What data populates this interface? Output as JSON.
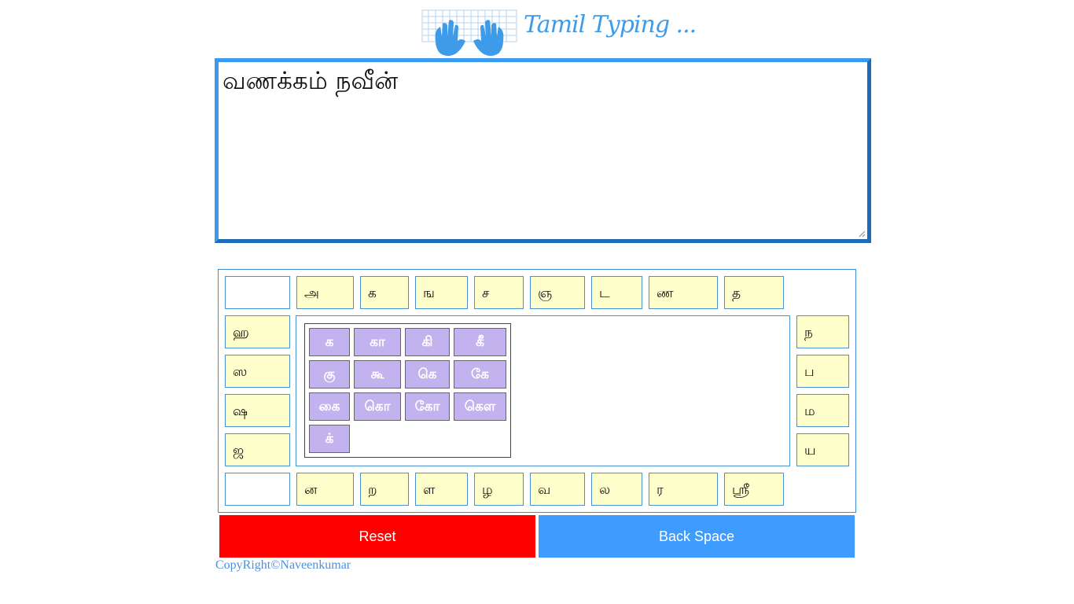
{
  "header": {
    "title": "Tamil Typing ...",
    "logo_icon": "keyboard-hands-icon"
  },
  "editor": {
    "value": "வணக்கம் நவீன்"
  },
  "keyboard": {
    "top_row": [
      "",
      "அ",
      "க",
      "ங",
      "ச",
      "ஞ",
      "ட",
      "ண",
      "த"
    ],
    "left_col": [
      "ஹ",
      "ஸ",
      "ஷ",
      "ஜ"
    ],
    "right_col": [
      "ந",
      "ப",
      "ம",
      "ய"
    ],
    "bottom_row": [
      "",
      "ன",
      "ற",
      "ள",
      "ழ",
      "வ",
      "ல",
      "ர",
      "ஸ்ரீ"
    ],
    "vowel_signs": [
      "க",
      "கா",
      "கி",
      "கீ",
      "கு",
      "கூ",
      "கெ",
      "கே",
      "கை",
      "கொ",
      "கோ",
      "கௌ",
      "க்"
    ]
  },
  "buttons": {
    "reset": "Reset",
    "backspace": "Back Space"
  },
  "footer": {
    "copyright": "CopyRight©Naveenkumar"
  },
  "colors": {
    "key_bg": "#ffffcc",
    "vowel_key_bg": "#c2b2ee",
    "reset_bg": "#ff0000",
    "backspace_bg": "#3d9cfe",
    "accent": "#3a9af0"
  }
}
